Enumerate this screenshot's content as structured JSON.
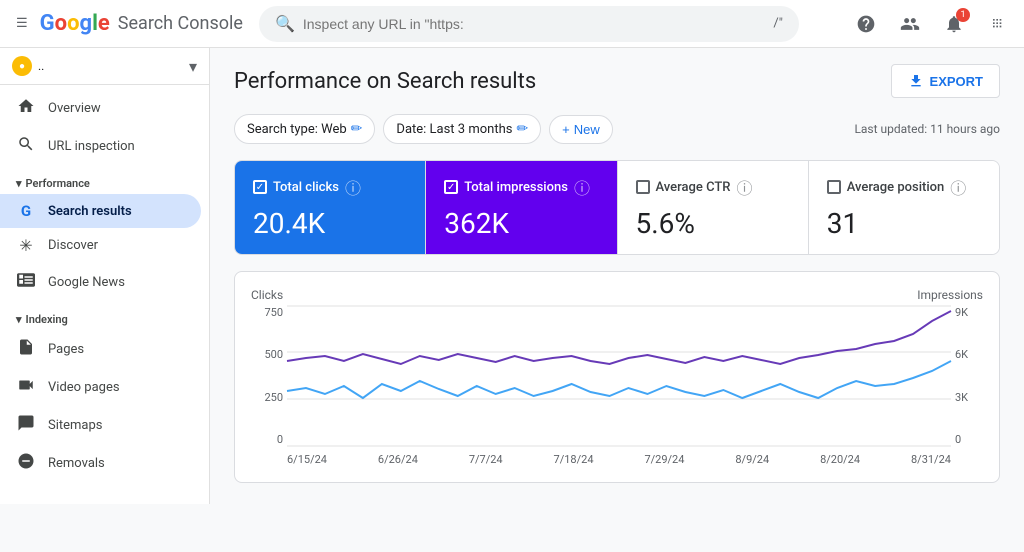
{
  "header": {
    "menu_icon": "☰",
    "google_letters": [
      {
        "char": "G",
        "color": "g-blue"
      },
      {
        "char": "o",
        "color": "g-red"
      },
      {
        "char": "o",
        "color": "g-yellow"
      },
      {
        "char": "g",
        "color": "g-blue2"
      },
      {
        "char": "l",
        "color": "g-green"
      },
      {
        "char": "e",
        "color": "g-red"
      }
    ],
    "app_title": "Search Console",
    "search_placeholder": "Inspect any URL in \"https:",
    "search_suffix": "/\"",
    "help_icon": "?",
    "account_icon": "👤",
    "notification_icon": "🔔",
    "notification_count": "1",
    "apps_icon": "⠿"
  },
  "sidebar": {
    "property_name": "..",
    "property_chevron": "▾",
    "items": [
      {
        "id": "overview",
        "label": "Overview",
        "icon": "🏠"
      },
      {
        "id": "url-inspection",
        "label": "URL inspection",
        "icon": "🔍"
      },
      {
        "section": "Performance",
        "expanded": true
      },
      {
        "id": "search-results",
        "label": "Search results",
        "icon": "G",
        "active": true
      },
      {
        "id": "discover",
        "label": "Discover",
        "icon": "✳"
      },
      {
        "id": "google-news",
        "label": "Google News",
        "icon": "📰"
      },
      {
        "section": "Indexing",
        "expanded": true
      },
      {
        "id": "pages",
        "label": "Pages",
        "icon": "📄"
      },
      {
        "id": "video-pages",
        "label": "Video pages",
        "icon": "🎬"
      },
      {
        "id": "sitemaps",
        "label": "Sitemaps",
        "icon": "🗺"
      },
      {
        "id": "removals",
        "label": "Removals",
        "icon": "🚫"
      }
    ]
  },
  "main": {
    "page_title": "Performance on Search results",
    "export_label": "EXPORT",
    "filters": {
      "search_type": "Search type: Web",
      "date_range": "Date: Last 3 months",
      "new_label": "New"
    },
    "last_updated": "Last updated: 11 hours ago",
    "metrics": [
      {
        "id": "total-clicks",
        "label": "Total clicks",
        "value": "20.4K",
        "checked": true,
        "style": "blue"
      },
      {
        "id": "total-impressions",
        "label": "Total impressions",
        "value": "362K",
        "checked": true,
        "style": "purple"
      },
      {
        "id": "avg-ctr",
        "label": "Average CTR",
        "value": "5.6%",
        "checked": false,
        "style": "plain"
      },
      {
        "id": "avg-position",
        "label": "Average position",
        "value": "31",
        "checked": false,
        "style": "plain"
      }
    ],
    "chart": {
      "left_axis_label": "Clicks",
      "right_axis_label": "Impressions",
      "y_left": [
        "750",
        "500",
        "250",
        "0"
      ],
      "y_right": [
        "9K",
        "6K",
        "3K",
        "0"
      ],
      "x_labels": [
        "6/15/24",
        "6/26/24",
        "7/7/24",
        "7/18/24",
        "7/29/24",
        "8/9/24",
        "8/20/24",
        "8/31/24"
      ]
    }
  }
}
